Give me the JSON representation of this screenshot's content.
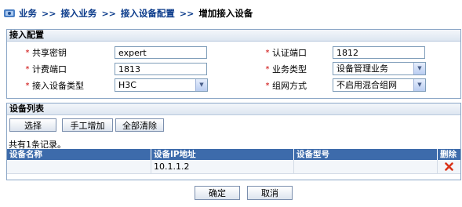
{
  "breadcrumb": {
    "items": [
      "业务",
      "接入业务",
      "接入设备配置"
    ],
    "separator": ">>",
    "current": "增加接入设备"
  },
  "config": {
    "title": "接入配置",
    "shared_key_label": "共享密钥",
    "shared_key_value": "expert",
    "auth_port_label": "认证端口",
    "auth_port_value": "1812",
    "acct_port_label": "计费端口",
    "acct_port_value": "1813",
    "service_type_label": "业务类型",
    "service_type_value": "设备管理业务",
    "device_type_label": "接入设备类型",
    "device_type_value": "H3C",
    "network_mode_label": "组网方式",
    "network_mode_value": "不启用混合组网",
    "required_mark": "*"
  },
  "device_list": {
    "title": "设备列表",
    "buttons": {
      "select": "选择",
      "manual_add": "手工增加",
      "clear_all": "全部清除"
    },
    "record_count": "共有1条记录。",
    "columns": [
      "设备名称",
      "设备IP地址",
      "设备型号",
      "删除"
    ],
    "rows": [
      {
        "name": "",
        "ip": "10.1.1.2",
        "model": ""
      }
    ]
  },
  "footer": {
    "ok": "确定",
    "cancel": "取消"
  },
  "colors": {
    "header_blue": "#3d6bab",
    "link_blue": "#0a3a8a",
    "required_red": "#cc0000",
    "delete_red": "#d9331a"
  }
}
